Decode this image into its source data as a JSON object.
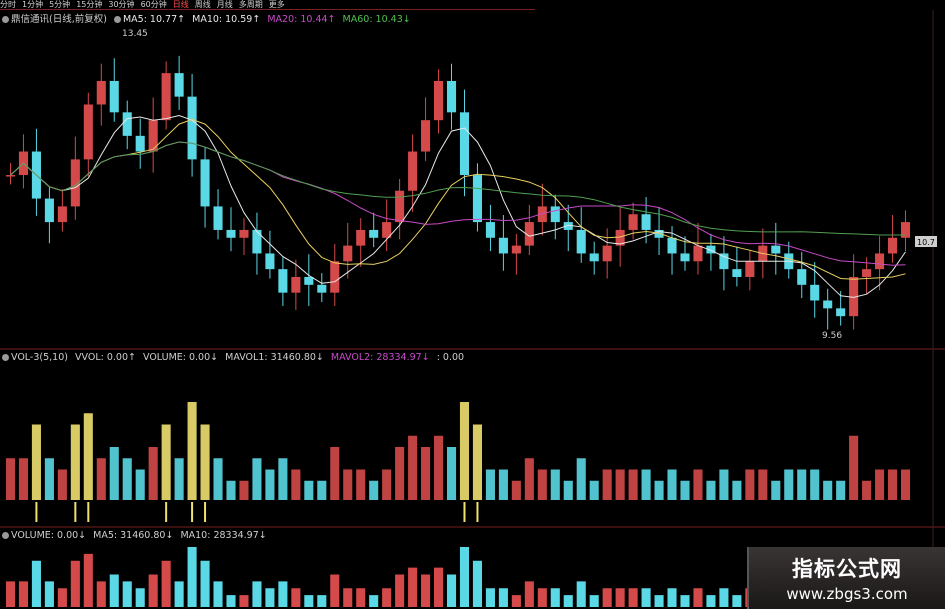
{
  "toolbar": {
    "items": [
      "分时",
      "1分钟",
      "5分钟",
      "15分钟",
      "30分钟",
      "60分钟",
      "日线",
      "周线",
      "月线",
      "多周期",
      "更多"
    ],
    "active": "日线"
  },
  "price_legend": {
    "stock": "鼎信通讯(日线,前复权)",
    "ma5": "MA5: 10.77↑",
    "ma10": "MA10: 10.59↑",
    "ma20": "MA20: 10.44↑",
    "ma60": "MA60: 10.43↓"
  },
  "vol3_legend": {
    "name": "VOL-3(5,10)",
    "vvol": "VVOL: 0.00↑",
    "volume": "VOLUME: 0.00↓",
    "mavol1": "MAVOL1: 31460.80↓",
    "mavol2": "MAVOL2: 28334.97↓",
    "extra": ": 0.00"
  },
  "volume_legend": {
    "volume": "VOLUME: 0.00↓",
    "ma5": "MA5: 31460.80↓",
    "ma10": "MA10: 28334.97↓"
  },
  "annotations": {
    "high": "13.45",
    "low": "9.56",
    "current": "10.7"
  },
  "watermark": {
    "title": "指标公式网",
    "url": "www.zbgs3.com"
  },
  "colors": {
    "up": "#d44a4a",
    "down": "#5ad8e6",
    "ma5": "#e8e8e8",
    "ma10": "#e8d060",
    "ma20": "#c84ac8",
    "ma60": "#50a050",
    "spike": "#f0e070",
    "magenta": "#e040c0",
    "green": "#40c040"
  },
  "chart_data": {
    "type": "candlestick",
    "price_range": [
      9.56,
      13.45
    ],
    "closes": [
      11.6,
      11.9,
      11.3,
      11.0,
      11.2,
      11.8,
      12.5,
      12.8,
      12.4,
      12.1,
      11.9,
      12.3,
      12.9,
      12.6,
      11.8,
      11.2,
      10.9,
      10.8,
      10.9,
      10.6,
      10.4,
      10.1,
      10.3,
      10.2,
      10.1,
      10.5,
      10.7,
      10.9,
      10.8,
      11.0,
      11.4,
      11.9,
      12.3,
      12.8,
      12.4,
      11.6,
      11.0,
      10.8,
      10.6,
      10.7,
      11.0,
      11.2,
      11.0,
      10.9,
      10.6,
      10.5,
      10.7,
      10.9,
      11.1,
      10.9,
      10.8,
      10.6,
      10.5,
      10.7,
      10.6,
      10.4,
      10.3,
      10.5,
      10.7,
      10.6,
      10.4,
      10.2,
      10.0,
      9.9,
      9.8,
      10.3,
      10.4,
      10.6,
      10.8,
      11.0
    ]
  }
}
